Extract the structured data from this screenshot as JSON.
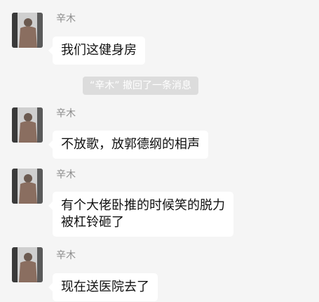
{
  "messages": [
    {
      "sender": "辛木",
      "lines": [
        "我们这健身房"
      ]
    },
    {
      "sender": "辛木",
      "lines": [
        "不放歌，放郭德纲的相声"
      ]
    },
    {
      "sender": "辛木",
      "lines": [
        "有个大佬卧推的时候笑的脱力",
        "被杠铃砸了"
      ]
    },
    {
      "sender": "辛木",
      "lines": [
        "现在送医院去了"
      ]
    }
  ],
  "system_notice": "“辛木” 撤回了一条消息",
  "colors": {
    "background": "#f5f5f5",
    "bubble": "#ffffff",
    "name_text": "#8a8a8a",
    "message_text": "#111111"
  }
}
